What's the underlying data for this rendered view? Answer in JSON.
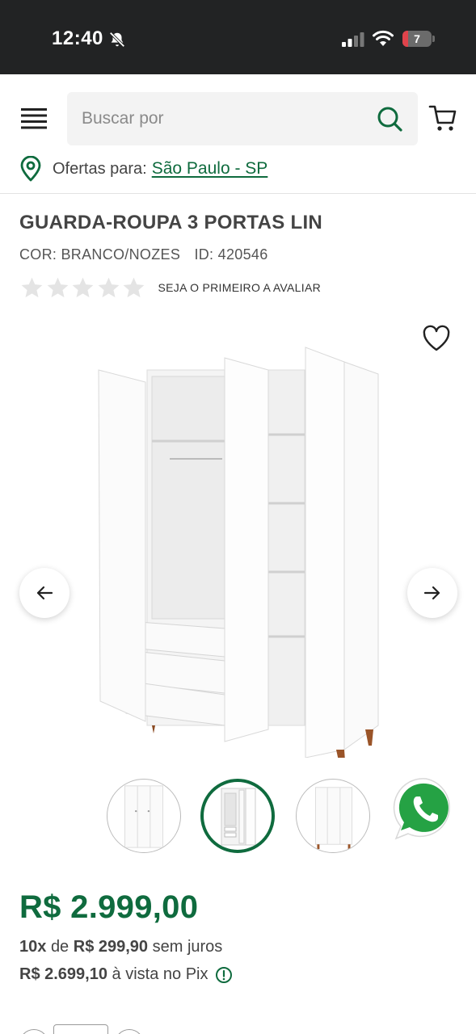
{
  "status_bar": {
    "time": "12:40",
    "battery_level": "7",
    "icons": [
      "bell-muted-icon",
      "signal-icon",
      "wifi-icon",
      "battery-icon"
    ]
  },
  "header": {
    "search_placeholder": "Buscar por",
    "location_label": "Ofertas para:",
    "location_value": "São Paulo - SP",
    "icons": [
      "menu-icon",
      "search-icon",
      "cart-icon",
      "location-pin-icon"
    ]
  },
  "product": {
    "title": "GUARDA-ROUPA 3 PORTAS LIN",
    "color": "COR: BRANCO/NOZES",
    "id": "ID: 420546",
    "rating_stars": 0,
    "rating_max": 5,
    "rating_text": "SEJA O PRIMEIRO A AVALIAR"
  },
  "gallery": {
    "thumbnail_count": 3,
    "active_thumbnail": 2,
    "icons": [
      "heart-icon",
      "arrow-left-icon",
      "arrow-right-icon",
      "whatsapp-icon"
    ]
  },
  "price": {
    "main": "R$ 2.999,00",
    "installments_count": "10x",
    "installments_connector": "de",
    "installment_value": "R$ 299,90",
    "installments_suffix": "sem juros",
    "pix_value": "R$ 2.699,10",
    "pix_text": "à vista no Pix"
  },
  "colors": {
    "brand_green": "#0f6b3e",
    "status_bar_bg": "#222324",
    "whatsapp_green": "#25a244"
  }
}
